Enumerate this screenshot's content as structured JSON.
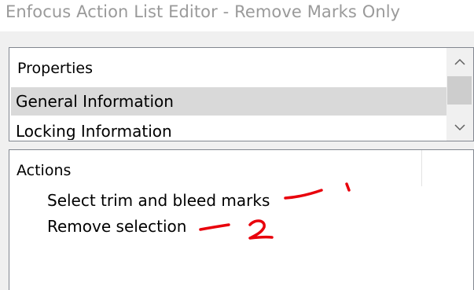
{
  "window": {
    "title": "Enfocus Action List Editor - Remove Marks Only"
  },
  "properties": {
    "header": "Properties",
    "items": [
      {
        "label": "General Information",
        "selected": true
      },
      {
        "label": "Locking Information",
        "selected": false
      }
    ],
    "scrollbar": {
      "up_icon": "chevron-up-icon",
      "down_icon": "chevron-down-icon"
    }
  },
  "actions": {
    "header": "Actions",
    "items": [
      {
        "label": "Select trim and bleed marks"
      },
      {
        "label": "Remove selection"
      }
    ]
  },
  "annotations": {
    "color": "#e8000b",
    "numbers": [
      "1",
      "2"
    ]
  }
}
